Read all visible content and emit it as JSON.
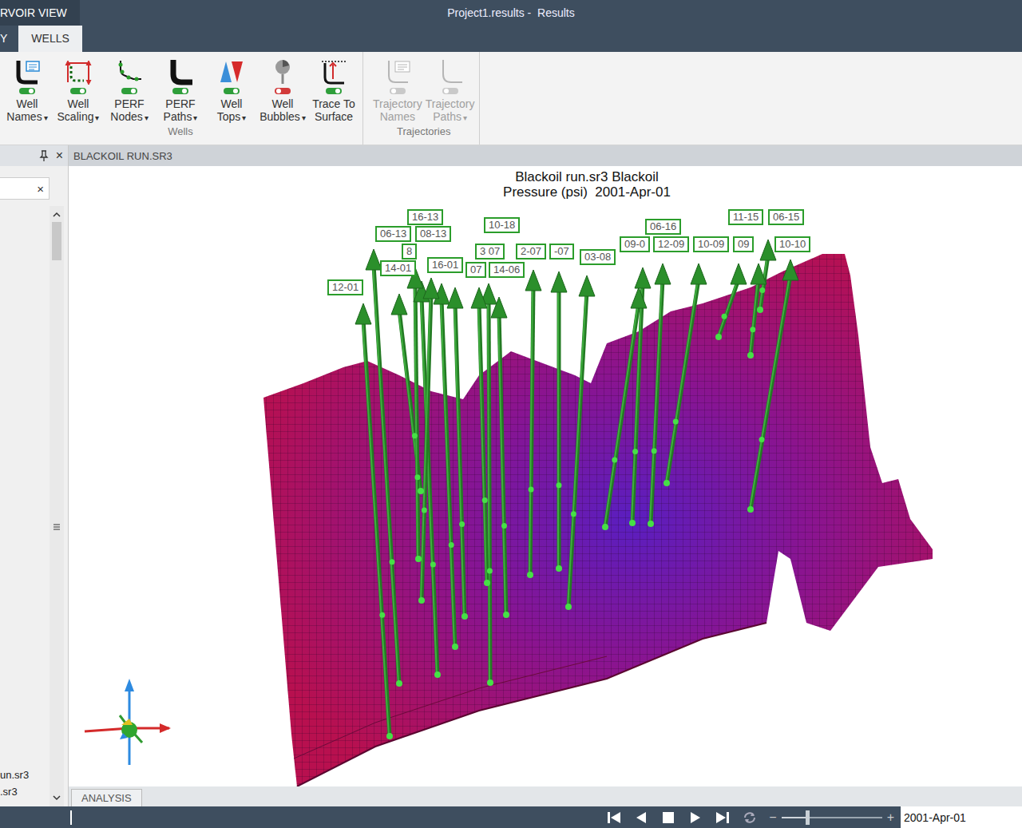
{
  "app": {
    "title_fragment": "RVOIR VIEW"
  },
  "window": {
    "title": "Project1.results -  Results"
  },
  "ribbon_tabs": [
    {
      "label": "Y",
      "selected": false
    },
    {
      "label": "WELLS",
      "selected": true
    }
  ],
  "ribbon_groups": [
    {
      "label": "Wells",
      "buttons": [
        {
          "label": [
            "Well",
            "Names"
          ],
          "arrow": "▾",
          "on": true,
          "disabled": false,
          "kind": "names"
        },
        {
          "label": [
            "Well",
            "Scaling"
          ],
          "arrow": "▾",
          "on": true,
          "disabled": false,
          "kind": "scaling"
        },
        {
          "label": [
            "PERF",
            "Nodes"
          ],
          "arrow": "▾",
          "on": true,
          "disabled": false,
          "kind": "perfnodes"
        },
        {
          "label": [
            "PERF",
            "Paths"
          ],
          "arrow": "▾",
          "on": true,
          "disabled": false,
          "kind": "perfpaths"
        },
        {
          "label": [
            "Well",
            "Tops"
          ],
          "arrow": "▾",
          "on": true,
          "disabled": false,
          "kind": "tops"
        },
        {
          "label": [
            "Well",
            "Bubbles"
          ],
          "arrow": "▾",
          "on": false,
          "disabled": false,
          "kind": "bubbles"
        },
        {
          "label": [
            "Trace To",
            "Surface"
          ],
          "on": true,
          "disabled": false,
          "kind": "trace"
        }
      ]
    },
    {
      "label": "Trajectories",
      "buttons": [
        {
          "label": [
            "Trajectory",
            "Names"
          ],
          "on": false,
          "disabled": true,
          "kind": "trajnames"
        },
        {
          "label": [
            "Trajectory",
            "Paths"
          ],
          "arrow": "▾",
          "on": false,
          "disabled": true,
          "kind": "trajpaths"
        }
      ]
    }
  ],
  "panel": {
    "close": "×",
    "search": {
      "value": "",
      "clear": "×"
    },
    "items": [
      "un.sr3",
      ".sr3"
    ]
  },
  "document_tabs": [
    {
      "label": "BLACKOIL RUN.SR3",
      "selected": true
    }
  ],
  "viewport": {
    "title": [
      "Blackoil run.sr3 Blackoil",
      "Pressure (psi)  2001-Apr-01"
    ],
    "wells": [
      {
        "name": "06-13"
      },
      {
        "name": "16-13"
      },
      {
        "name": "08-13"
      },
      {
        "name": "10-18"
      },
      {
        "name": "14-01"
      },
      {
        "name": "16-01"
      },
      {
        "name": "12-01"
      },
      {
        "name": "14-06"
      },
      {
        "name": "2-07"
      },
      {
        "name": "-07"
      },
      {
        "name": "3 07"
      },
      {
        "name": "07"
      },
      {
        "name": "03-08"
      },
      {
        "name": "09-0"
      },
      {
        "name": "12-09"
      },
      {
        "name": "10-09"
      },
      {
        "name": "06-16"
      },
      {
        "name": "09"
      },
      {
        "name": "11-15"
      },
      {
        "name": "06-15"
      },
      {
        "name": "10-10"
      },
      {
        "name": "8"
      }
    ]
  },
  "bottom_tabs": [
    {
      "label": "ANALYSIS",
      "selected": true
    }
  ],
  "player": {
    "minus": "−",
    "plus": "+",
    "level": 0.26,
    "date": "2001-Apr-01"
  }
}
